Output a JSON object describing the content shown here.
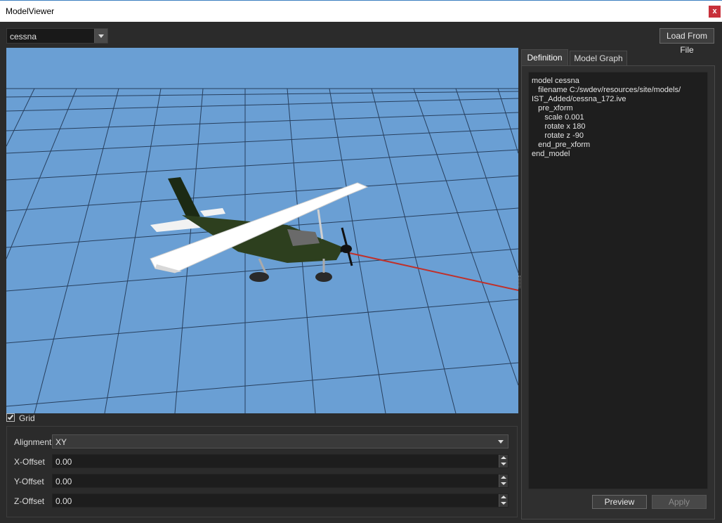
{
  "window": {
    "title": "ModelViewer",
    "close_label": "x"
  },
  "toolbar": {
    "model_selected": "cessna",
    "load_button": "Load From File"
  },
  "viewport": {
    "background": "#6a9fd4",
    "grid_color": "#1c2f4a",
    "axis_color": "#c0302a"
  },
  "grid": {
    "checkbox_label": "Grid",
    "checked": true,
    "alignment_label": "Alignment",
    "alignment_value": "XY",
    "x_offset_label": "X-Offset",
    "x_offset_value": "0.00",
    "y_offset_label": "Y-Offset",
    "y_offset_value": "0.00",
    "z_offset_label": "Z-Offset",
    "z_offset_value": "0.00"
  },
  "tabs": [
    {
      "label": "Definition",
      "active": true
    },
    {
      "label": "Model Graph",
      "active": false
    }
  ],
  "definition": {
    "text": "model cessna\n   filename C:/swdev/resources/site/models/\nIST_Added/cessna_172.ive\n   pre_xform\n      scale 0.001\n      rotate x 180\n      rotate z -90\n   end_pre_xform\nend_model"
  },
  "actions": {
    "preview": "Preview",
    "apply": "Apply"
  }
}
